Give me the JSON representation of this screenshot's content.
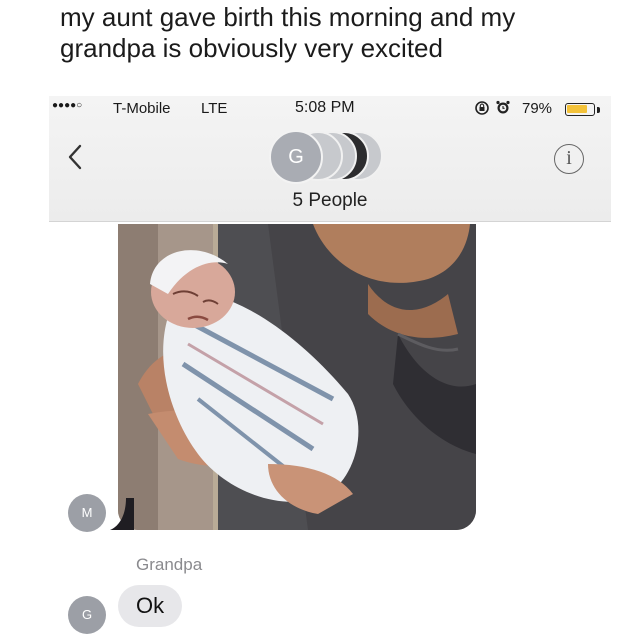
{
  "caption": {
    "line1": "my aunt gave birth this morning and my",
    "line2": "grandpa is obviously very excited"
  },
  "status_bar": {
    "signal": "●●●●○",
    "carrier": "T-Mobile",
    "network": "LTE",
    "time": "5:08 PM",
    "battery_percent": "79%",
    "battery_level": 0.79,
    "battery_color": "#f3c23a",
    "icons": [
      "lock-rotation-icon",
      "alarm-icon",
      "battery-icon"
    ]
  },
  "conversation": {
    "group_initial": "G",
    "people_count": "5 People",
    "back_icon": "chevron-left-icon",
    "info_icon": "info-icon",
    "info_glyph": "i"
  },
  "messages": [
    {
      "type": "photo",
      "sender_initial": "M",
      "description_icon": "photo-newborn"
    },
    {
      "type": "text",
      "sender_name": "Grandpa",
      "sender_initial": "G",
      "text": "Ok"
    }
  ]
}
